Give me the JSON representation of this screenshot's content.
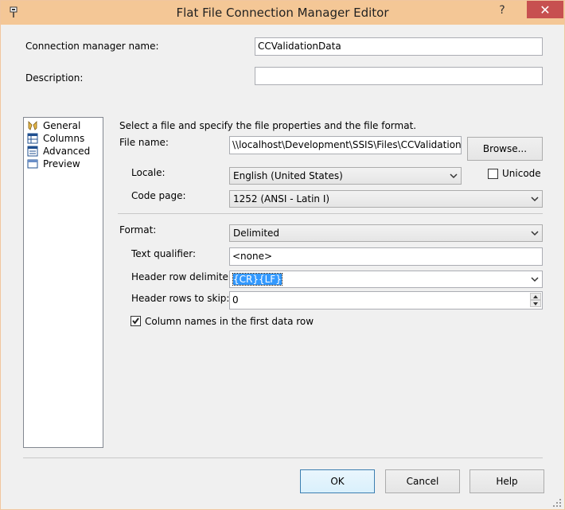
{
  "window": {
    "title": "Flat File Connection Manager Editor",
    "help_glyph": "?",
    "close_glyph": "✕"
  },
  "top": {
    "conn_name_label": "Connection manager name:",
    "conn_name_value": "CCValidationData",
    "description_label": "Description:",
    "description_value": ""
  },
  "nav": {
    "items": [
      {
        "label": "General"
      },
      {
        "label": "Columns"
      },
      {
        "label": "Advanced"
      },
      {
        "label": "Preview"
      }
    ]
  },
  "general": {
    "intro": "Select a file and specify the file properties and the file format.",
    "file_name_label": "File name:",
    "file_name_value": "\\\\localhost\\Development\\SSIS\\Files\\CCValidation\\CC",
    "browse_label": "Browse...",
    "locale_label": "Locale:",
    "locale_value": "English (United States)",
    "unicode_label": "Unicode",
    "code_page_label": "Code page:",
    "code_page_value": "1252  (ANSI - Latin I)",
    "format_label": "Format:",
    "format_value": "Delimited",
    "text_qualifier_label": "Text qualifier:",
    "text_qualifier_value": "<none>",
    "header_delim_label": "Header row delimiter:",
    "header_delim_value": "{CR}{LF}",
    "header_skip_label": "Header rows to skip:",
    "header_skip_value": "0",
    "column_names_label": "Column names in the first data row",
    "column_names_checked": true
  },
  "footer": {
    "ok_label": "OK",
    "cancel_label": "Cancel",
    "help_label": "Help"
  },
  "colors": {
    "titlebar": "#f4c796",
    "close": "#c75050",
    "selection": "#3399ff"
  }
}
